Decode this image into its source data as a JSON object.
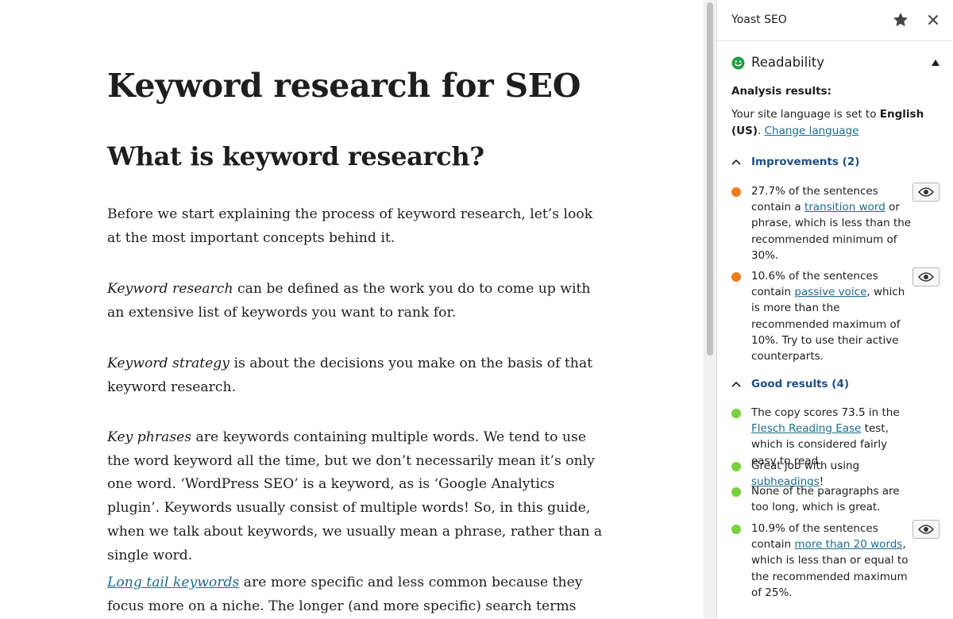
{
  "editor": {
    "title": "Keyword research for SEO",
    "heading": "What is keyword research?",
    "p1": "Before we start explaining the process of keyword research, let’s look at the most important concepts behind it.",
    "p2_em": "Keyword research",
    "p2_rest": " can be defined as the work you do to come up with an extensive list of keywords you want to rank for.",
    "p3_em": "Keyword strategy",
    "p3_rest": " is about the decisions you make on the basis of that keyword research.",
    "p4_em": "Key phrases",
    "p4_rest": " are keywords containing multiple words. We tend to use the word keyword all the time, but we don’t necessarily mean it’s only one word. ‘WordPress SEO’ is a keyword, as is ‘Google Analytics plugin’. Keywords usually consist of multiple words! So, in this guide, when we talk about keywords, we usually mean a phrase, rather than a single word.",
    "p5_link": "Long tail keywords",
    "p5_rest": " are more specific and less common because they focus more on a niche. The longer (and more specific) search terms are, the easier"
  },
  "sidebar": {
    "title": "Yoast SEO",
    "panel_title": "Readability",
    "analysis_label": "Analysis results:",
    "lang_prefix": "Your site language is set to ",
    "lang_value": "English (US)",
    "lang_suffix": ". ",
    "lang_link": "Change language",
    "improvements_label": "Improvements (2)",
    "good_label": "Good results (4)",
    "items": [
      {
        "pre": "27.7% of the sentences contain a ",
        "link": "transition word",
        "post": " or phrase, which is less than the recommended minimum of 30%.",
        "status": "orange"
      },
      {
        "pre": "10.6% of the sentences contain ",
        "link": "passive voice",
        "post": ", which is more than the recommended maximum of 10%. Try to use their active counterparts.",
        "status": "orange"
      },
      {
        "pre": "The copy scores 73.5 in the ",
        "link": "Flesch Reading Ease",
        "post": " test, which is considered fairly easy to read.",
        "status": "green"
      },
      {
        "pre": "Great job with using ",
        "link": "subheadings",
        "post": "!",
        "status": "green"
      },
      {
        "pre": "None of the paragraphs are too long, which is great.",
        "link": "",
        "post": "",
        "status": "green"
      },
      {
        "pre": "10.9% of the sentences contain ",
        "link": "more than 20 words",
        "post": ", which is less than or equal to the recommended maximum of 25%.",
        "status": "green"
      }
    ]
  },
  "colors": {
    "orange": "#ee7c1b",
    "green": "#7ad03a",
    "link": "#1d6c8e",
    "section_heading": "#1d4f86"
  },
  "icons": [
    "star-icon",
    "close-icon",
    "smile-icon",
    "caret-up-icon",
    "chevron-up-icon",
    "eye-icon"
  ]
}
